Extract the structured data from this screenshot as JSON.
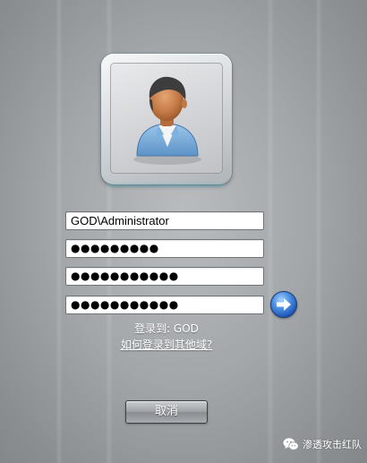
{
  "login": {
    "username_value": "GOD\\Administrator",
    "password_value": "●●●●●●●●●",
    "new_password_value": "●●●●●●●●●●●",
    "confirm_password_value": "●●●●●●●●●●●",
    "domain_label": "登录到: GOD",
    "domain_help_link": "如何登录到其他域?",
    "cancel_label": "取消"
  },
  "watermark": {
    "text": "渗透攻击红队",
    "icon": "wechat-icon"
  },
  "icons": {
    "avatar": "user-avatar-icon",
    "submit": "arrow-right-icon"
  },
  "colors": {
    "background": "#a2a6a8",
    "submit_button": "#2a67c9",
    "cancel_button": "#9fa3a7"
  }
}
